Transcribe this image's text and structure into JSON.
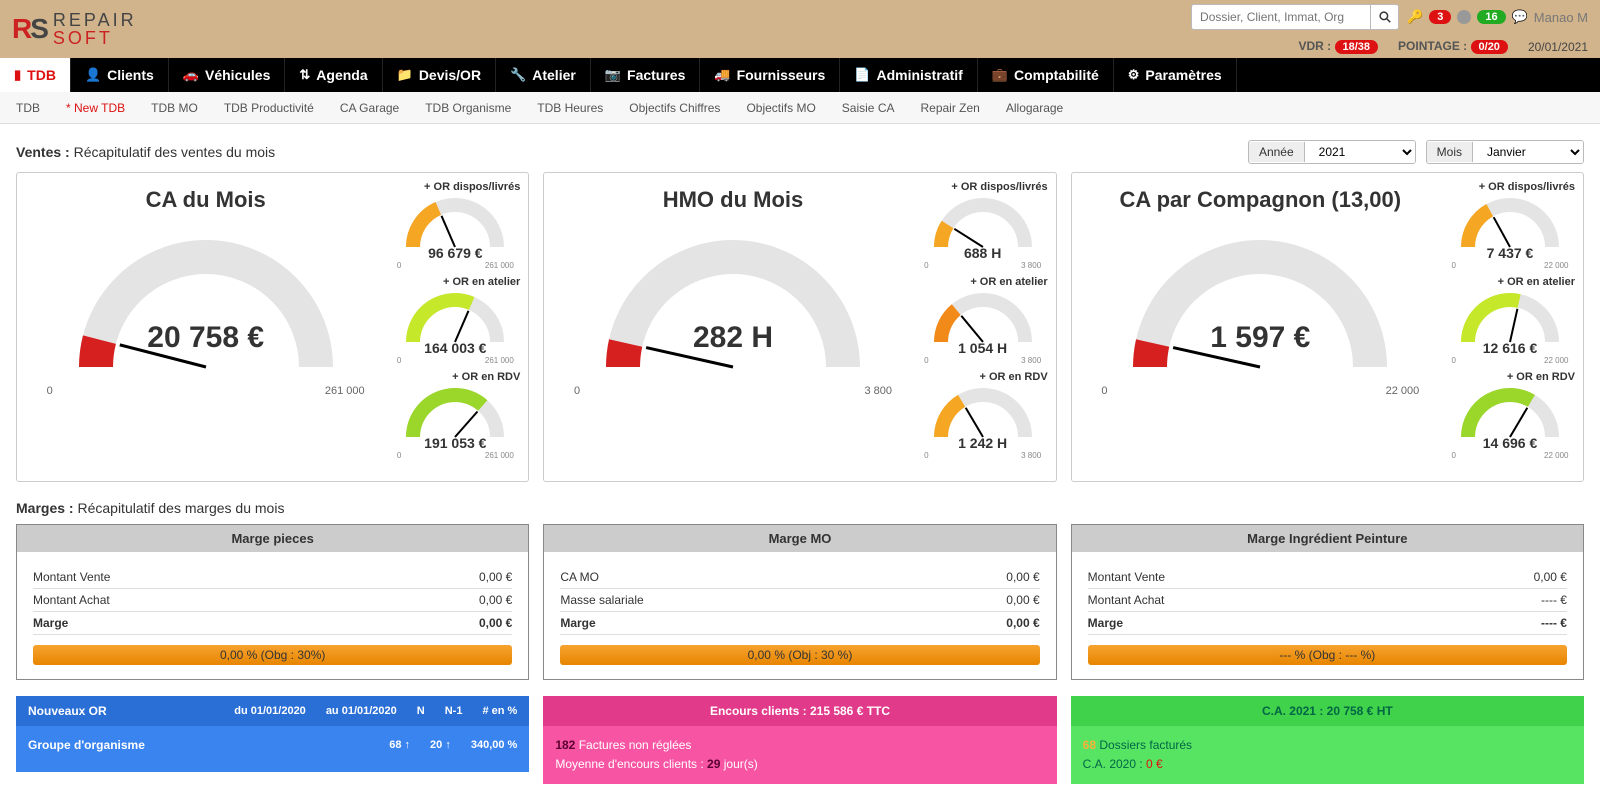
{
  "header": {
    "search_placeholder": "Dossier, Client, Immat, Org",
    "vdr_label": "VDR :",
    "vdr_badge": "18/38",
    "pointage_label": "POINTAGE :",
    "pointage_badge": "0/20",
    "date": "20/01/2021",
    "user": "Manao M",
    "key_badge": "3",
    "info_badge": "16"
  },
  "logo": {
    "brand_top": "REPAIR",
    "brand_bot": "SOFT"
  },
  "nav": [
    {
      "icon": "chart",
      "label": "TDB",
      "active": true
    },
    {
      "icon": "user",
      "label": "Clients"
    },
    {
      "icon": "car",
      "label": "Véhicules"
    },
    {
      "icon": "swap",
      "label": "Agenda"
    },
    {
      "icon": "folder",
      "label": "Devis/OR"
    },
    {
      "icon": "wrench",
      "label": "Atelier"
    },
    {
      "icon": "camera",
      "label": "Factures"
    },
    {
      "icon": "truck",
      "label": "Fournisseurs"
    },
    {
      "icon": "doc",
      "label": "Administratif"
    },
    {
      "icon": "briefcase",
      "label": "Comptabilité"
    },
    {
      "icon": "gear",
      "label": "Paramètres"
    }
  ],
  "subnav": [
    "TDB",
    "* New TDB",
    "TDB MO",
    "TDB Productivité",
    "CA Garage",
    "TDB Organisme",
    "TDB Heures",
    "Objectifs Chiffres",
    "Objectifs MO",
    "Saisie CA",
    "Repair Zen",
    "Allogarage"
  ],
  "subnav_active_index": 1,
  "ventes": {
    "title_bold": "Ventes :",
    "title_rest": "Récapitulatif des ventes du mois",
    "filter_year_label": "Année",
    "filter_year_value": "2021",
    "filter_month_label": "Mois",
    "filter_month_value": "Janvier"
  },
  "gauges": [
    {
      "title": "CA du Mois",
      "value": "20 758 €",
      "min": "0",
      "max": "261 000",
      "minis": [
        {
          "label": "+ OR dispos/livrés",
          "value": "96 679 €",
          "min": "0",
          "max": "261 000",
          "color": "#f5a623",
          "frac": 0.37
        },
        {
          "label": "+ OR en atelier",
          "value": "164 003 €",
          "min": "0",
          "max": "261 000",
          "color": "#c5e82a",
          "frac": 0.63
        },
        {
          "label": "+ OR en RDV",
          "value": "191 053 €",
          "min": "0",
          "max": "261 000",
          "color": "#9bd62a",
          "frac": 0.73
        }
      ],
      "frac": 0.08
    },
    {
      "title": "HMO du Mois",
      "value": "282 H",
      "min": "0",
      "max": "3 800",
      "minis": [
        {
          "label": "+ OR dispos/livrés",
          "value": "688 H",
          "min": "0",
          "max": "3 800",
          "color": "#f5a623",
          "frac": 0.18
        },
        {
          "label": "+ OR en atelier",
          "value": "1 054 H",
          "min": "0",
          "max": "3 800",
          "color": "#f28a1a",
          "frac": 0.28
        },
        {
          "label": "+ OR en RDV",
          "value": "1 242 H",
          "min": "0",
          "max": "3 800",
          "color": "#f5a623",
          "frac": 0.33
        }
      ],
      "frac": 0.07
    },
    {
      "title": "CA par Compagnon (13,00)",
      "value": "1 597 €",
      "min": "0",
      "max": "22 000",
      "minis": [
        {
          "label": "+ OR dispos/livrés",
          "value": "7 437 €",
          "min": "0",
          "max": "22 000",
          "color": "#f5a623",
          "frac": 0.34
        },
        {
          "label": "+ OR en atelier",
          "value": "12 616 €",
          "min": "0",
          "max": "22 000",
          "color": "#c5e82a",
          "frac": 0.57
        },
        {
          "label": "+ OR en RDV",
          "value": "14 696 €",
          "min": "0",
          "max": "22 000",
          "color": "#9bd62a",
          "frac": 0.67
        }
      ],
      "frac": 0.07
    }
  ],
  "marges": {
    "title_bold": "Marges :",
    "title_rest": "Récapitulatif des marges du mois",
    "cards": [
      {
        "head": "Marge pieces",
        "rows": [
          [
            "Montant Vente",
            "0,00 €"
          ],
          [
            "Montant Achat",
            "0,00 €"
          ],
          [
            "Marge",
            "0,00 €"
          ]
        ],
        "bar": "0,00 % (Obg : 30%)"
      },
      {
        "head": "Marge MO",
        "rows": [
          [
            "CA MO",
            "0,00 €"
          ],
          [
            "Masse salariale",
            "0,00 €"
          ],
          [
            "Marge",
            "0,00 €"
          ]
        ],
        "bar": "0,00 % (Obj : 30 %)"
      },
      {
        "head": "Marge Ingrédient Peinture",
        "rows": [
          [
            "Montant Vente",
            "0,00 €"
          ],
          [
            "Montant Achat",
            "---- €"
          ],
          [
            "Marge",
            "---- €"
          ]
        ],
        "bar": "--- % (Obg : --- %)"
      }
    ]
  },
  "bottom": {
    "blue": {
      "head_label": "Nouveaux OR",
      "du_label": "du",
      "du": "01/01/2020",
      "au_label": "au",
      "au": "01/01/2020",
      "c1": "N",
      "c2": "N-1",
      "c3": "# en %",
      "body_label": "Groupe d'organisme",
      "v1": "68 ↑",
      "v2": "20 ↑",
      "v3": "340,00 %"
    },
    "pink": {
      "head": "Encours clients : 215 586 € TTC",
      "l1a": "182",
      "l1b": " Factures non réglées",
      "l2a": "Moyenne d'encours clients : ",
      "l2b": "29",
      "l2c": " jour(s)"
    },
    "green": {
      "head": "C.A. 2021 : 20 758 € HT",
      "l1a": "68",
      "l1b": " Dossiers facturés",
      "l2a": "C.A. 2020 : ",
      "l2b": "0 €"
    }
  },
  "chart_data": [
    {
      "type": "gauge",
      "title": "CA du Mois",
      "value": 20758,
      "min": 0,
      "max": 261000,
      "sub": [
        {
          "label": "+ OR dispos/livrés",
          "value": 96679
        },
        {
          "label": "+ OR en atelier",
          "value": 164003
        },
        {
          "label": "+ OR en RDV",
          "value": 191053
        }
      ]
    },
    {
      "type": "gauge",
      "title": "HMO du Mois",
      "value": 282,
      "min": 0,
      "max": 3800,
      "sub": [
        {
          "label": "+ OR dispos/livrés",
          "value": 688
        },
        {
          "label": "+ OR en atelier",
          "value": 1054
        },
        {
          "label": "+ OR en RDV",
          "value": 1242
        }
      ]
    },
    {
      "type": "gauge",
      "title": "CA par Compagnon (13,00)",
      "value": 1597,
      "min": 0,
      "max": 22000,
      "sub": [
        {
          "label": "+ OR dispos/livrés",
          "value": 7437
        },
        {
          "label": "+ OR en atelier",
          "value": 12616
        },
        {
          "label": "+ OR en RDV",
          "value": 14696
        }
      ]
    }
  ]
}
